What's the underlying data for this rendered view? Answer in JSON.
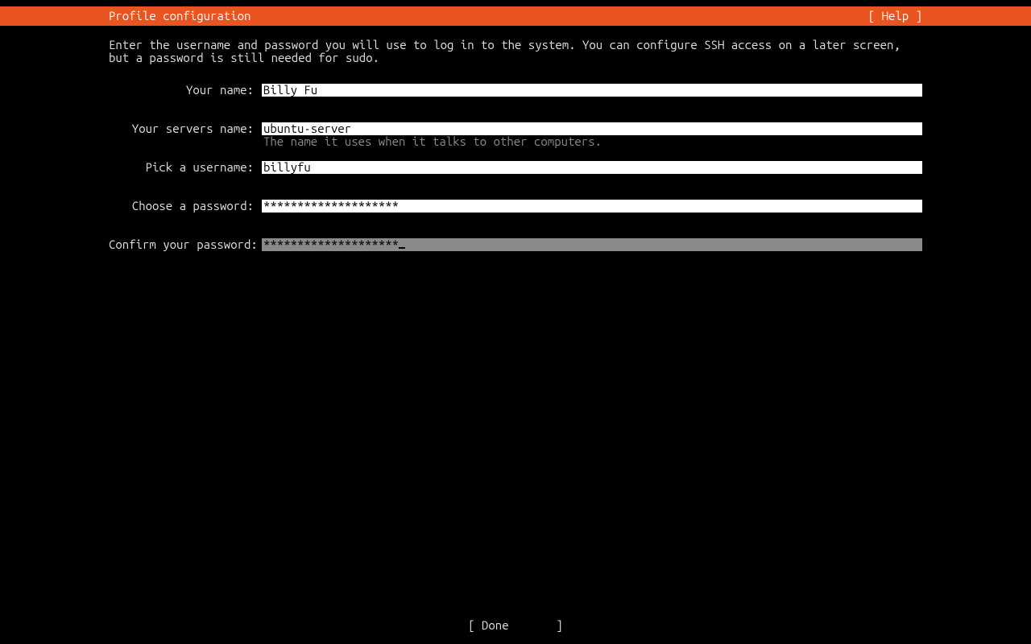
{
  "header": {
    "title": "Profile configuration",
    "help": "[ Help ]"
  },
  "instructions": "Enter the username and password you will use to log in to the system. You can configure SSH access on a later screen, but a password is still needed for sudo.",
  "form": {
    "name_label": "Your name:",
    "name_value": "Billy Fu",
    "server_label": "Your servers name:",
    "server_value": "ubuntu-server",
    "server_hint": "The name it uses when it talks to other computers.",
    "username_label": "Pick a username:",
    "username_value": "billyfu",
    "password_label": "Choose a password:",
    "password_value": "********************",
    "confirm_label": "Confirm your password:",
    "confirm_value": "********************"
  },
  "footer": {
    "done": "[ Done       ]"
  }
}
